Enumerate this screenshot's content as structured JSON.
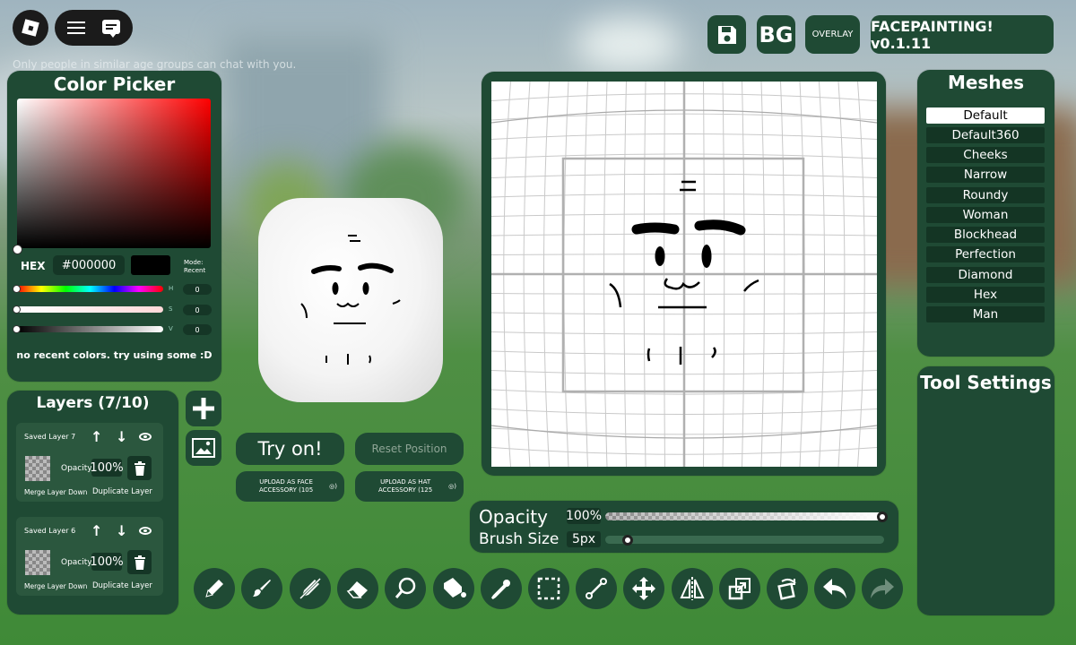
{
  "chat_notice": "Only people in similar age groups can chat with you.",
  "top_bar": {
    "bg_label": "BG",
    "overlay_label": "OVERLAY",
    "version_label": "FACEPAINTING! v0.1.11"
  },
  "color_picker": {
    "title": "Color Picker",
    "hex_label": "HEX",
    "hex_value": "#000000",
    "mode_label": "Mode:",
    "mode_value": "Recent",
    "sliders": [
      {
        "label": "H",
        "value": "0"
      },
      {
        "label": "S",
        "value": "0"
      },
      {
        "label": "V",
        "value": "0"
      }
    ],
    "recent_text": "no recent colors. try using some :D"
  },
  "layers": {
    "title": "Layers (7/10)",
    "items": [
      {
        "name": "Saved Layer 7",
        "opacity_label": "Opacity",
        "opacity_value": "100%",
        "merge_label": "Merge Layer Down",
        "duplicate_label": "Duplicate Layer"
      },
      {
        "name": "Saved Layer 6",
        "opacity_label": "Opacity",
        "opacity_value": "100%",
        "merge_label": "Merge Layer Down",
        "duplicate_label": "Duplicate Layer"
      }
    ]
  },
  "preview": {
    "try_on_label": "Try on!",
    "reset_label": "Reset Position",
    "upload_face_label": "UPLOAD AS FACE ACCESSORY (105",
    "upload_hat_label": "UPLOAD AS HAT ACCESSORY (125"
  },
  "meshes": {
    "title": "Meshes",
    "items": [
      "Default",
      "Default360",
      "Cheeks",
      "Narrow",
      "Roundy",
      "Woman",
      "Blockhead",
      "Perfection",
      "Diamond",
      "Hex",
      "Man"
    ],
    "selected": "Default"
  },
  "tool_settings": {
    "title": "Tool Settings"
  },
  "brush": {
    "opacity_label": "Opacity",
    "opacity_value": "100%",
    "opacity_fraction": 1.0,
    "size_label": "Brush Size",
    "size_value": "5px",
    "size_fraction": 0.08
  },
  "toolbar": {
    "tools": [
      "pencil-icon",
      "brush-icon",
      "eraser-stroke-icon",
      "eraser-icon",
      "lasso-icon",
      "fill-bucket-icon",
      "eyedropper-icon",
      "marquee-select-icon",
      "line-icon",
      "move-icon",
      "mirror-icon",
      "resize-icon",
      "rotate-icon",
      "undo-icon",
      "redo-icon"
    ]
  },
  "colors": {
    "panel": "#1f4a34",
    "panel_dark": "#143524",
    "selected_mesh": "#ffffff",
    "brush_color": "#000000"
  }
}
